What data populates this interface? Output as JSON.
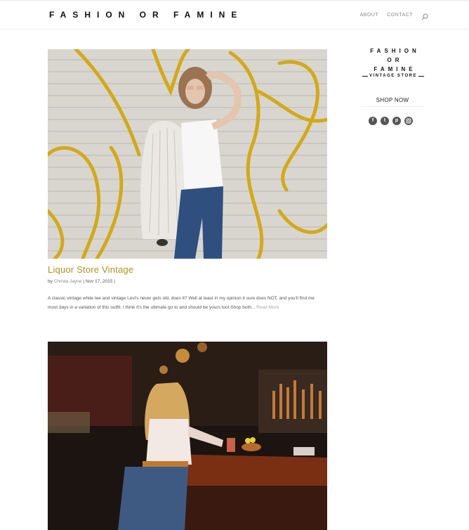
{
  "header": {
    "logo": "FASHION OR FAMINE",
    "nav": [
      "ABOUT",
      "CONTACT"
    ],
    "search_icon": "search-icon"
  },
  "posts": [
    {
      "title": "Liquor Store Vintage",
      "meta_prefix": "by ",
      "author": "Christa Jayne",
      "meta_sep1": " | ",
      "date": "Nov 17, 2015",
      "meta_sep2": " |",
      "excerpt": "A classic vintage white tee and vintage Levi's never gets old, does it? Well at least in my opinion it sure does NOT, and you'll find me most days in a variation of this outfit.  I think it's the ultimate go to and should be yours too!  Shop both...",
      "read_more": "Read More"
    }
  ],
  "sidebar": {
    "logo_lines": [
      "FASHION",
      "OR",
      "FAMINE"
    ],
    "logo_sub": "VINTAGE STORE",
    "shop_now": "SHOP NOW",
    "social_icons": [
      "facebook-icon",
      "twitter-icon",
      "pinterest-icon",
      "instagram-icon"
    ]
  }
}
